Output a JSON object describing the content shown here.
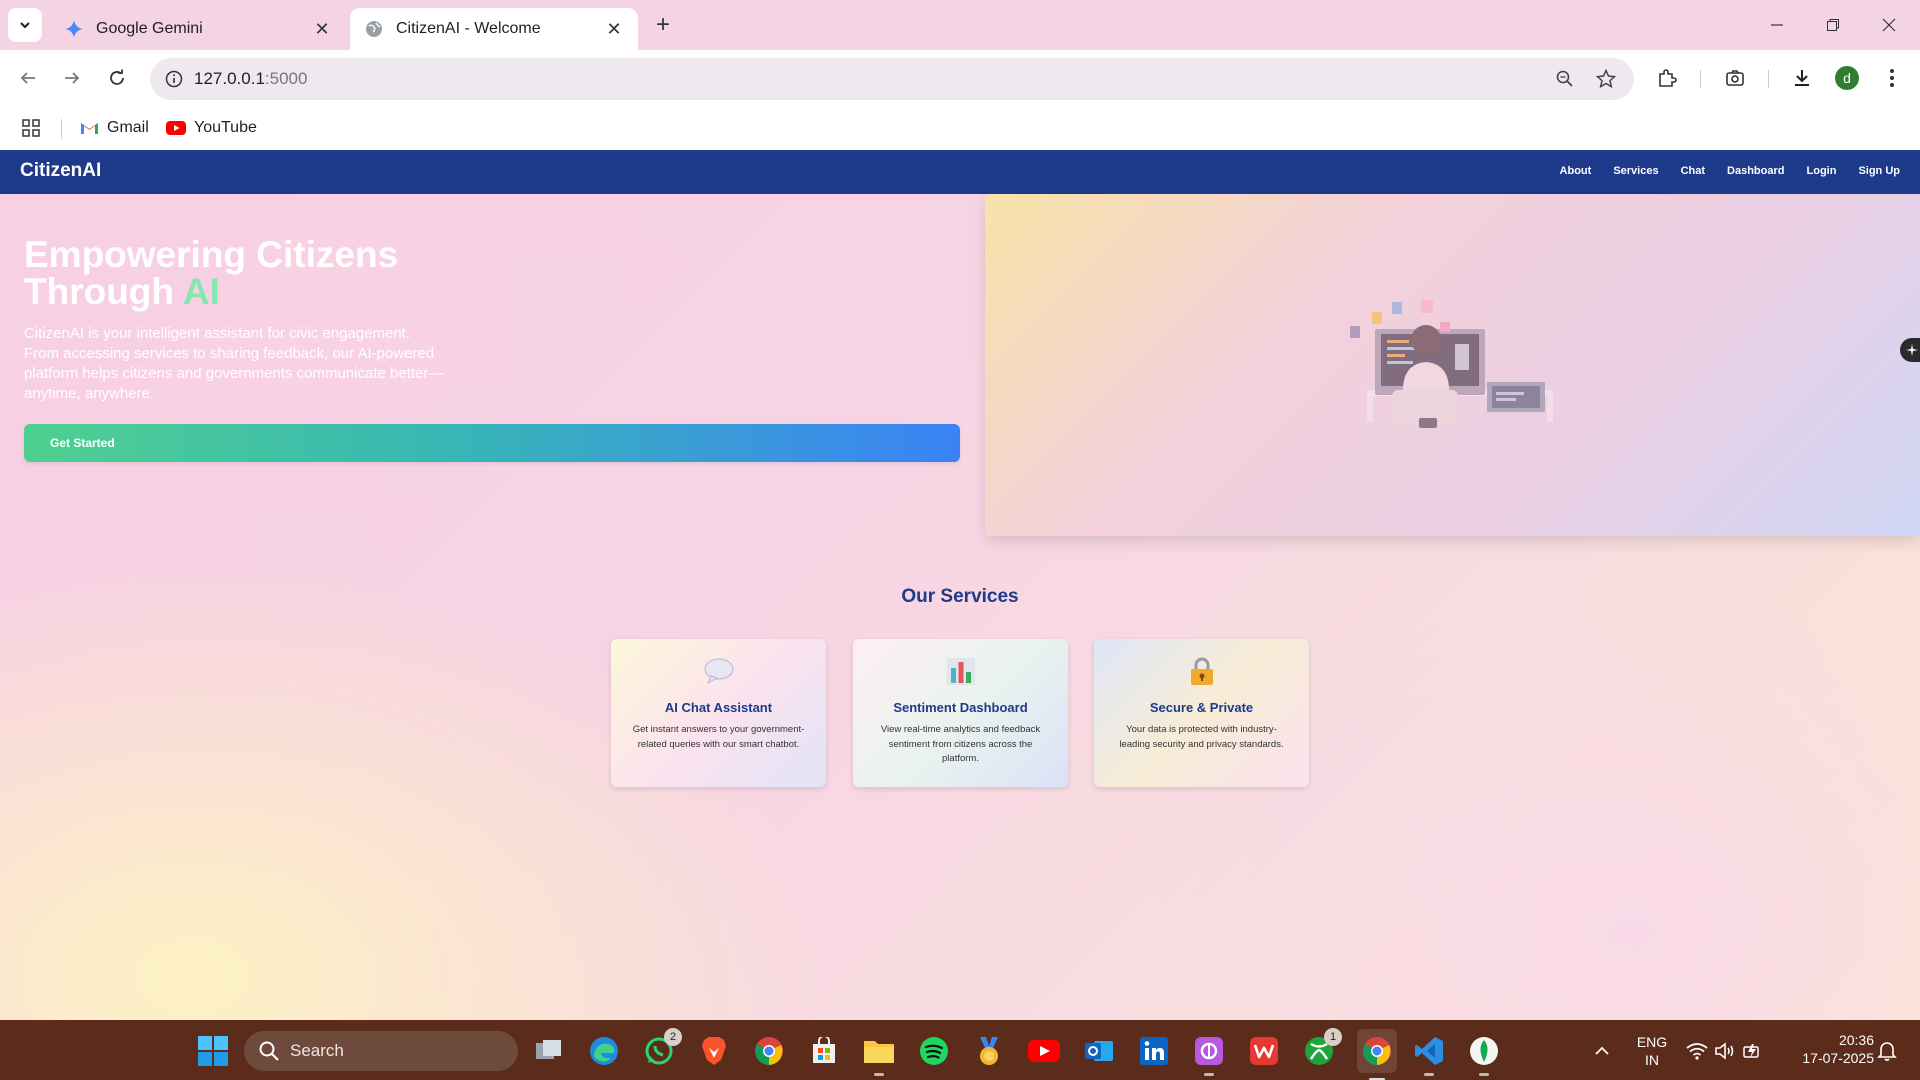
{
  "browser": {
    "tabs": [
      {
        "title": "Google Gemini",
        "icon": "gemini-icon"
      },
      {
        "title": "CitizenAI - Welcome",
        "icon": "globe-icon"
      }
    ],
    "url_host": "127.0.0.1",
    "url_port": ":5000",
    "bookmarks": [
      {
        "label": "Gmail",
        "icon": "gmail-icon"
      },
      {
        "label": "YouTube",
        "icon": "youtube-icon"
      }
    ],
    "profile_initial": "d"
  },
  "site": {
    "brand": "CitizenAI",
    "nav": [
      "About",
      "Services",
      "Chat",
      "Dashboard",
      "Login",
      "Sign Up"
    ],
    "hero": {
      "title_line1": "Empowering Citizens",
      "title_line2_pre": "Through ",
      "title_accent": "AI",
      "text": "CitizenAI is your intelligent assistant for civic engagement. From accessing services to sharing feedback, our AI-powered platform helps citizens and governments communicate better—anytime, anywhere.",
      "cta": "Get Started"
    },
    "services_title": "Our Services",
    "services": [
      {
        "title": "AI Chat Assistant",
        "desc": "Get instant answers to your government-related queries with our smart chatbot.",
        "icon": "speech-bubble-icon"
      },
      {
        "title": "Sentiment Dashboard",
        "desc": "View real-time analytics and feedback sentiment from citizens across the platform.",
        "icon": "bar-chart-icon"
      },
      {
        "title": "Secure & Private",
        "desc": "Your data is protected with industry-leading security and privacy standards.",
        "icon": "lock-icon"
      }
    ]
  },
  "taskbar": {
    "search_placeholder": "Search",
    "whatsapp_badge": "2",
    "xbox_badge": "1",
    "lang_line1": "ENG",
    "lang_line2": "IN",
    "time": "20:36",
    "date": "17-07-2025"
  },
  "colors": {
    "site_nav": "#1e3a8a",
    "accent_green": "#86e8b0",
    "cta_start": "#4fd08f",
    "cta_end": "#3b82f6",
    "taskbar": "#5b2c1c"
  }
}
